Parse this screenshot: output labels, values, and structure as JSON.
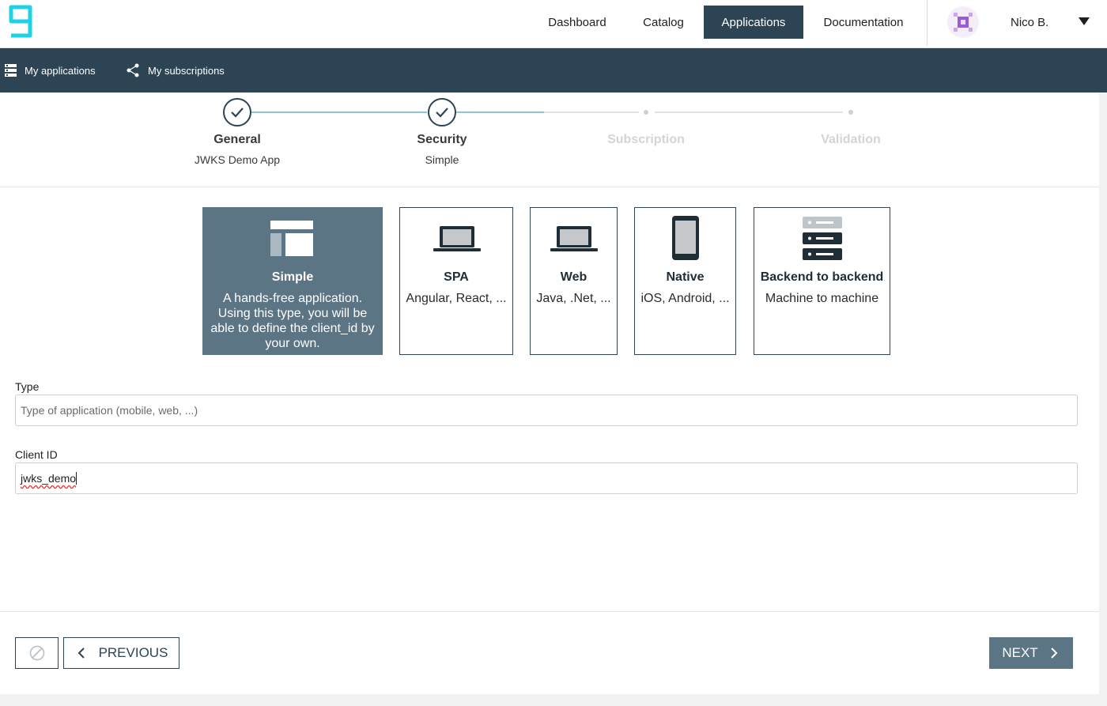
{
  "header": {
    "nav": [
      {
        "label": "Dashboard"
      },
      {
        "label": "Catalog"
      },
      {
        "label": "Applications",
        "active": true
      },
      {
        "label": "Documentation"
      }
    ],
    "user_name": "Nico B.",
    "accent": "#2c4453",
    "logo_color": "#1ed2e6"
  },
  "subnav": {
    "my_applications": "My applications",
    "my_subscriptions": "My subscriptions"
  },
  "stepper": {
    "steps": [
      {
        "title": "General",
        "subtitle": "JWKS Demo App",
        "state": "done"
      },
      {
        "title": "Security",
        "subtitle": "Simple",
        "state": "done"
      },
      {
        "title": "Subscription",
        "subtitle": "",
        "state": "pending"
      },
      {
        "title": "Validation",
        "subtitle": "",
        "state": "pending"
      }
    ]
  },
  "app_types": [
    {
      "title": "Simple",
      "description": "A hands-free application. Using this type, you will be able to define the client_id by your own.",
      "icon": "layout-icon",
      "selected": true
    },
    {
      "title": "SPA",
      "description": "Angular, React, ...",
      "icon": "laptop-icon",
      "selected": false
    },
    {
      "title": "Web",
      "description": "Java, .Net, ...",
      "icon": "laptop-icon",
      "selected": false
    },
    {
      "title": "Native",
      "description": "iOS, Android, ...",
      "icon": "phone-icon",
      "selected": false
    },
    {
      "title": "Backend to backend",
      "description": "Machine to machine",
      "icon": "server-icon",
      "selected": false
    }
  ],
  "form": {
    "type_label": "Type",
    "type_placeholder": "Type of application (mobile, web, ...)",
    "type_value": "",
    "client_id_label": "Client ID",
    "client_id_value": "jwks_demo"
  },
  "footer": {
    "cancel_icon": "cancel-icon",
    "previous_label": "PREVIOUS",
    "next_label": "NEXT"
  }
}
